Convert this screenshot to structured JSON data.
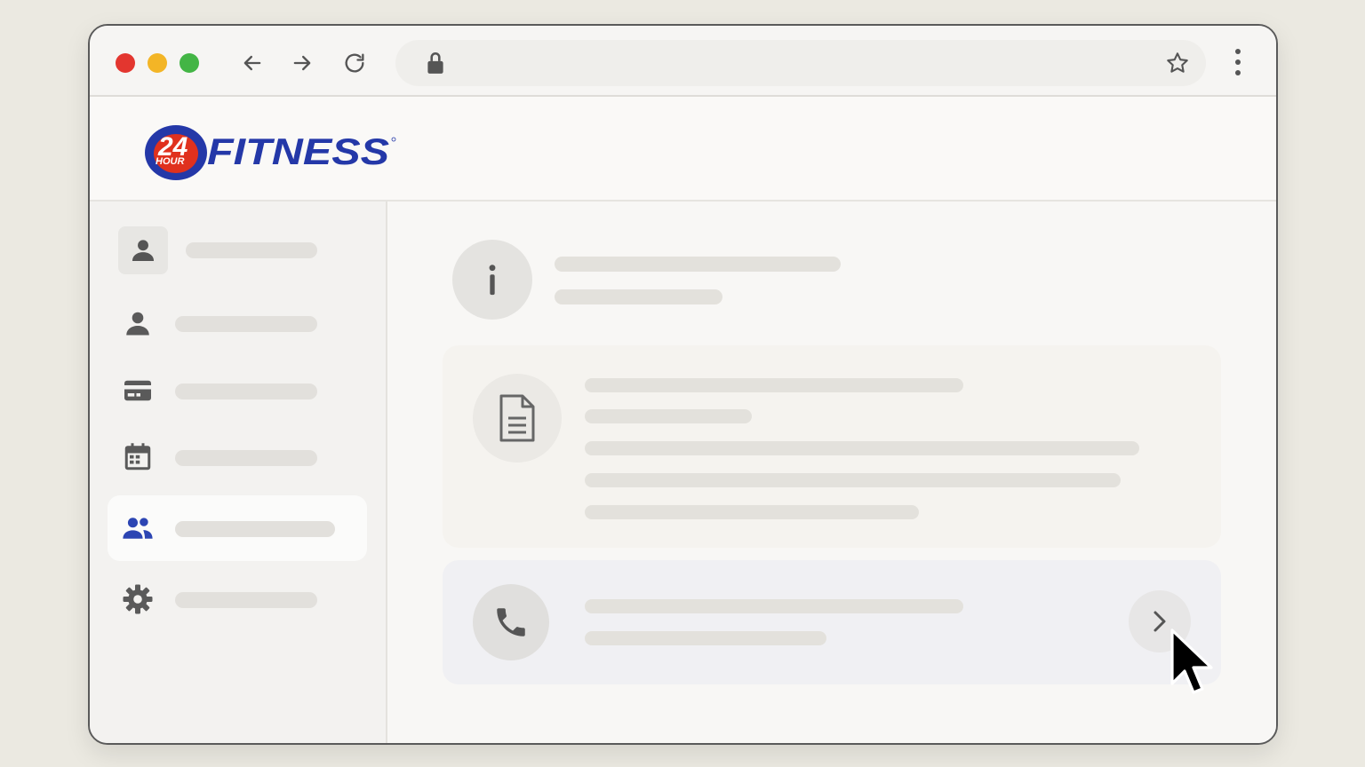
{
  "browser": {
    "icons": {
      "back": "arrow-left-icon",
      "forward": "arrow-right-icon",
      "reload": "reload-icon",
      "lock": "lock-icon",
      "bookmark": "star-icon",
      "menu": "kebab-menu-icon"
    },
    "colors": {
      "close": "#e3362f",
      "minimize": "#f3b526",
      "maximize": "#43b545"
    }
  },
  "logo": {
    "text": "FITNESS",
    "badge_number": "24",
    "badge_word": "HOUR",
    "colors": {
      "blue": "#2438a8",
      "red": "#e0311e"
    }
  },
  "sidebar": {
    "items": [
      {
        "icon": "person-icon",
        "active": false
      },
      {
        "icon": "person-icon",
        "active": false
      },
      {
        "icon": "credit-card-icon",
        "active": false
      },
      {
        "icon": "calendar-icon",
        "active": false
      },
      {
        "icon": "people-icon",
        "active": true
      },
      {
        "icon": "gear-icon",
        "active": false
      }
    ],
    "active_color": "#2c45b3"
  },
  "main": {
    "info_icon": "info-icon",
    "document_icon": "document-icon",
    "phone_icon": "phone-icon",
    "chevron_icon": "chevron-right-icon"
  }
}
